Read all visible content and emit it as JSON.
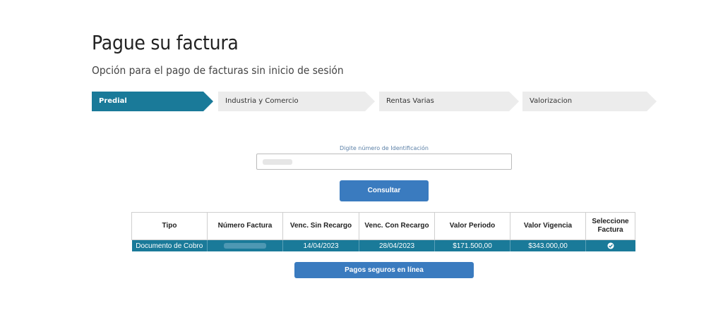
{
  "page": {
    "title": "Pague su factura",
    "subtitle": "Opción para el pago de facturas sin inicio de sesión"
  },
  "tabs": [
    {
      "label": "Predial",
      "active": true
    },
    {
      "label": "Industria y Comercio",
      "active": false
    },
    {
      "label": "Rentas Varias",
      "active": false
    },
    {
      "label": "Valorizacion",
      "active": false
    }
  ],
  "form": {
    "id_label": "Digite número de Identificación",
    "consultar_label": "Consultar"
  },
  "table": {
    "headers": [
      "Tipo",
      "Número Factura",
      "Venc. Sin Recargo",
      "Venc. Con Recargo",
      "Valor Periodo",
      "Valor Vigencia",
      "Seleccione Factura"
    ],
    "rows": [
      {
        "tipo": "Documento de Cobro",
        "numero_factura": "",
        "venc_sin_recargo": "14/04/2023",
        "venc_con_recargo": "28/04/2023",
        "valor_periodo": "$171.500,00",
        "valor_vigencia": "$343.000,00",
        "selected_icon": "check-circle-icon"
      }
    ]
  },
  "actions": {
    "pagos_label": "Pagos seguros en línea"
  },
  "colors": {
    "primary": "#1a7a99",
    "button": "#3a7bbf",
    "tab_inactive": "#ececec"
  }
}
